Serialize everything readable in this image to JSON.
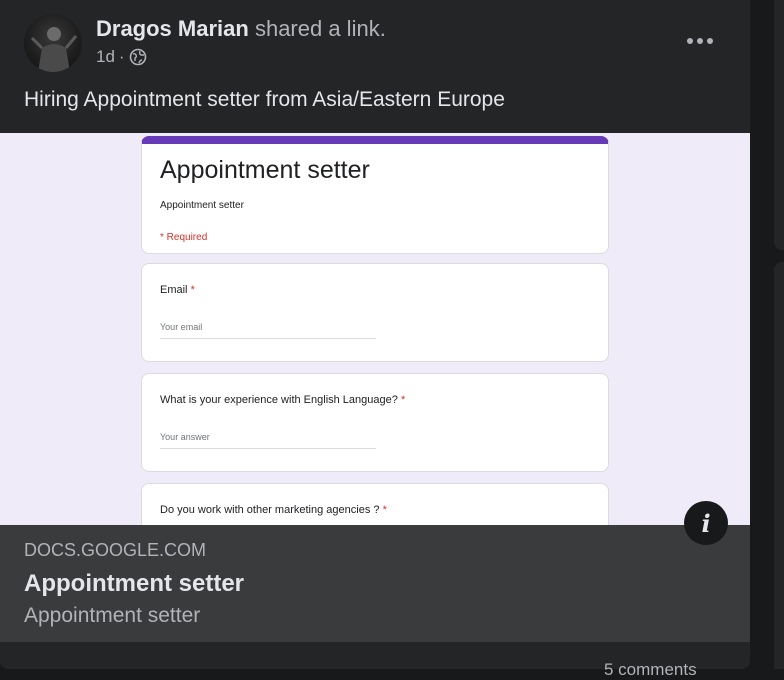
{
  "post": {
    "author": "Dragos Marian",
    "action": "shared a link.",
    "time": "1d",
    "separator": "·",
    "privacy_icon": "globe-icon",
    "more_icon": "more-horizontal-icon",
    "text": "Hiring Appointment setter from Asia/Eastern Europe"
  },
  "form_preview": {
    "title": "Appointment setter",
    "description": "Appointment setter",
    "required_note": "* Required",
    "questions": [
      {
        "label": "Email",
        "star": "*",
        "placeholder": "Your email"
      },
      {
        "label": "What is your experience with English Language?",
        "star": "*",
        "placeholder": "Your answer"
      },
      {
        "label": "Do you work with other marketing agencies ?",
        "star": "*"
      }
    ],
    "accent_color": "#673ab7"
  },
  "link": {
    "domain": "DOCS.GOOGLE.COM",
    "title": "Appointment setter",
    "description": "Appointment setter",
    "info_icon": "info-icon"
  },
  "footer": {
    "partial_text": "5 comments"
  },
  "colors": {
    "background": "#18191a",
    "card": "#242526",
    "link_meta_bg": "#3a3b3c",
    "primary_text": "#e4e6eb",
    "secondary_text": "#b0b3b8"
  }
}
